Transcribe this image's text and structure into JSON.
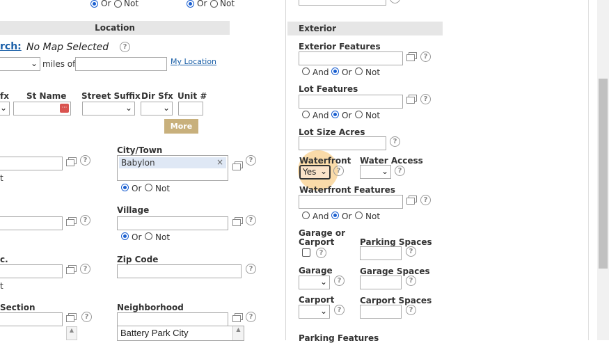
{
  "radio_or": "Or",
  "radio_not": "Not",
  "radio_and": "And",
  "location": {
    "header": "Location",
    "map_search_label": "rch:",
    "map_status": "No Map Selected",
    "miles_of": "miles of",
    "my_location": "My Location",
    "col_sfx": "fx",
    "col_st_name": "St Name",
    "col_street_suffix": "Street Suffix",
    "col_dir_sfx": "Dir Sfx",
    "col_unit": "Unit #",
    "more_button": "More",
    "city_town_label": "City/Town",
    "city_token": "Babylon",
    "village_label": "Village",
    "zip_label": "Zip Code",
    "partial_label_1": "t",
    "partial_label_2": "c.",
    "partial_label_3": "t",
    "section_label": "Section",
    "neighborhood_label": "Neighborhood",
    "neighborhood_option": "Battery Park City"
  },
  "exterior": {
    "header": "Exterior",
    "exterior_features": "Exterior Features",
    "lot_features": "Lot Features",
    "lot_size_acres": "Lot Size Acres",
    "waterfront": "Waterfront",
    "waterfront_value": "Yes",
    "water_access": "Water Access",
    "waterfront_features": "Waterfront Features",
    "garage_or_carport_1": "Garage or",
    "garage_or_carport_2": "Carport",
    "parking_spaces": "Parking Spaces",
    "garage": "Garage",
    "garage_spaces": "Garage Spaces",
    "carport": "Carport",
    "carport_spaces": "Carport Spaces",
    "parking_features": "Parking Features"
  },
  "colors": {
    "link": "#1a5fa8",
    "more_button": "#c8b07c",
    "section_header": "#e6e6e6",
    "token_bg": "#dfe8f5",
    "highlight": "#f5b041"
  }
}
